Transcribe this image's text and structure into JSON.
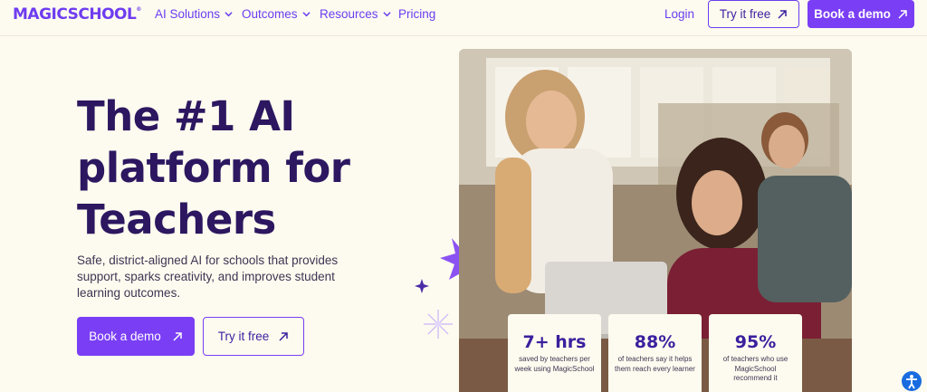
{
  "nav": {
    "logo": "MAGICSCHOOL",
    "logo_mark": "®",
    "links": [
      {
        "label": "AI Solutions",
        "has_dropdown": true
      },
      {
        "label": "Outcomes",
        "has_dropdown": true
      },
      {
        "label": "Resources",
        "has_dropdown": true
      },
      {
        "label": "Pricing",
        "has_dropdown": false
      }
    ],
    "login": "Login",
    "try_free": "Try it free",
    "book_demo": "Book a demo"
  },
  "hero": {
    "headline_lines": [
      "The #1 AI",
      "platform for",
      "Teachers"
    ],
    "subtitle": "Safe, district-aligned AI for schools that provides support, sparks creativity, and improves student learning outcomes.",
    "cta_primary": "Book a demo",
    "cta_secondary": "Try it free"
  },
  "stats": [
    {
      "value": "7+ hrs",
      "desc": "saved by teachers per week using MagicSchool"
    },
    {
      "value": "88%",
      "desc": "of teachers say it helps them reach every learner"
    },
    {
      "value": "95%",
      "desc": "of teachers who use MagicSchool recommend it"
    }
  ],
  "colors": {
    "brand_purple": "#7a3ef5",
    "heading": "#2c1760",
    "background": "#fdfbef"
  },
  "icons": {
    "arrow": "arrow-up-right-icon",
    "chevron": "chevron-down-icon",
    "accessibility": "accessibility-icon"
  }
}
